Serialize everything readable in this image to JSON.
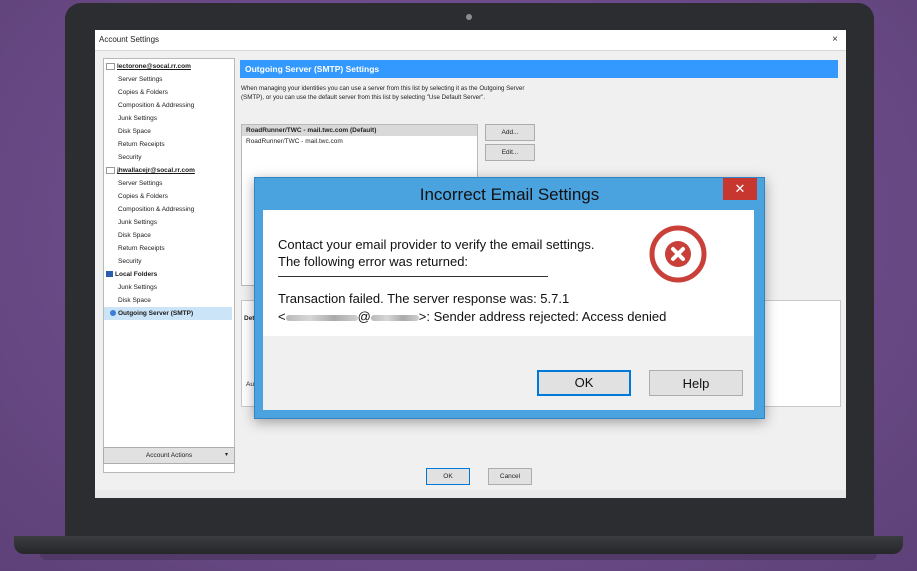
{
  "window": {
    "title": "Account Settings",
    "close_glyph": "×"
  },
  "tree": {
    "accounts": [
      {
        "name": "lectorone@socal.rr.com",
        "items": [
          "Server Settings",
          "Copies & Folders",
          "Composition & Addressing",
          "Junk Settings",
          "Disk Space",
          "Return Receipts",
          "Security"
        ]
      },
      {
        "name": "jhwallacejr@socal.rr.com",
        "items": [
          "Server Settings",
          "Copies & Folders",
          "Composition & Addressing",
          "Junk Settings",
          "Disk Space",
          "Return Receipts",
          "Security"
        ]
      },
      {
        "name": "Local Folders",
        "items": [
          "Junk Settings",
          "Disk Space"
        ]
      }
    ],
    "selected": "Outgoing Server (SMTP)",
    "account_actions": "Account Actions",
    "account_actions_arrow": "▾"
  },
  "panel": {
    "header": "Outgoing Server (SMTP) Settings",
    "description": "When managing your identities you can use a server from this list by selecting it as the Outgoing Server (SMTP), or you can use the default server from this list by selecting \"Use Default Server\".",
    "servers": [
      "RoadRunner/TWC - mail.twc.com (Default)",
      "RoadRunner/TWC - mail.twc.com"
    ],
    "add_label": "Add...",
    "edit_label": "Edit...",
    "details_label": "Det",
    "details_frag2": "Au"
  },
  "footer": {
    "ok_label": "OK",
    "cancel_label": "Cancel"
  },
  "dialog": {
    "title": "Incorrect Email Settings",
    "close_glyph": "✕",
    "line1": "Contact your email provider to verify the email settings.",
    "line2": "The following error was returned:",
    "error_line1": "Transaction failed. The server response was: 5.7.1",
    "error_prefix": "<",
    "error_at": "@",
    "error_suffix": ">: Sender address rejected: Access denied",
    "ok_label": "OK",
    "help_label": "Help",
    "icon": "error-x-icon",
    "icon_color": "#c9403a"
  },
  "colors": {
    "accent": "#3399ff",
    "dialog_frame": "#4aa3df",
    "background": "#6f4e8c"
  }
}
